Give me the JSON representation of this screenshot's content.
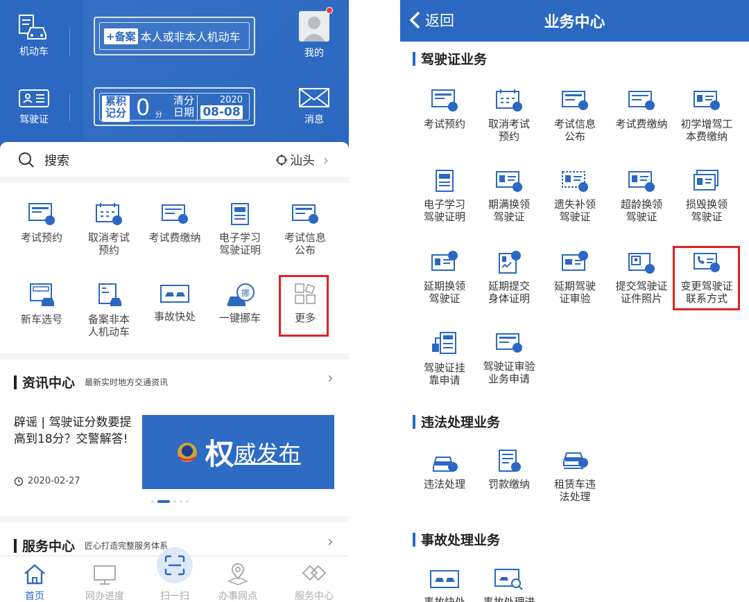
{
  "left": {
    "header": {
      "vehicle_label": "机动车",
      "license_label": "驾驶证",
      "plate_tag": "+备案",
      "plate_text": "本人或非本人机动车",
      "score_label_1": "累积",
      "score_label_2": "记分",
      "score_value": "0",
      "score_unit": "分",
      "clear_label_1": "清分",
      "clear_label_2": "日期",
      "clear_year": "2020",
      "clear_date": "08-08",
      "mine_label": "我的",
      "message_label": "消息"
    },
    "search": {
      "placeholder": "搜索",
      "city": "汕头"
    },
    "grid": [
      {
        "label": "考试预约"
      },
      {
        "label": "取消考试\n预约"
      },
      {
        "label": "考试费缴纳"
      },
      {
        "label": "电子学习\n驾驶证明"
      },
      {
        "label": "考试信息\n公布"
      },
      {
        "label": "新车选号"
      },
      {
        "label": "备案非本\n人机动车"
      },
      {
        "label": "事故快处"
      },
      {
        "label": "一键挪车"
      },
      {
        "label": "更多"
      }
    ],
    "news": {
      "title": "资讯中心",
      "subtitle": "最新实时地方交通资讯",
      "headline": "辟谣 | 驾驶证分数要提高到18分？交警解答!",
      "date": "2020-02-27",
      "banner_text_big": "权",
      "banner_text": "威发布"
    },
    "service": {
      "title": "服务中心",
      "subtitle": "匠心打造完整服务体系"
    },
    "tabs": [
      "首页",
      "网办进度",
      "扫一扫",
      "办事网点",
      "服务中心"
    ]
  },
  "right": {
    "back_label": "返回",
    "title": "业务中心",
    "sections": [
      {
        "title": "驾驶证业务"
      },
      {
        "title": "违法处理业务"
      },
      {
        "title": "事故处理业务"
      }
    ],
    "license_items": [
      "考试预约",
      "取消考试\n预约",
      "考试信息\n公布",
      "考试费缴纳",
      "初学增驾工\n本费缴纳",
      "电子学习\n驾驶证明",
      "期满换领\n驾驶证",
      "遗失补领\n驾驶证",
      "超龄换领\n驾驶证",
      "损毁换领\n驾驶证",
      "延期换领\n驾驶证",
      "延期提交\n身体证明",
      "延期驾驶\n证审验",
      "提交驾驶证\n证件照片",
      "变更驾驶证\n联系方式",
      "驾驶证挂\n靠申请",
      "驾驶证审验\n业务申请"
    ],
    "violation_items": [
      "违法处理",
      "罚款缴纳",
      "租赁车违\n法处理"
    ],
    "accident_items": [
      "事故快处",
      "事故处理进"
    ]
  },
  "colors": {
    "brand": "#2b68c1",
    "highlight": "#e02020"
  }
}
